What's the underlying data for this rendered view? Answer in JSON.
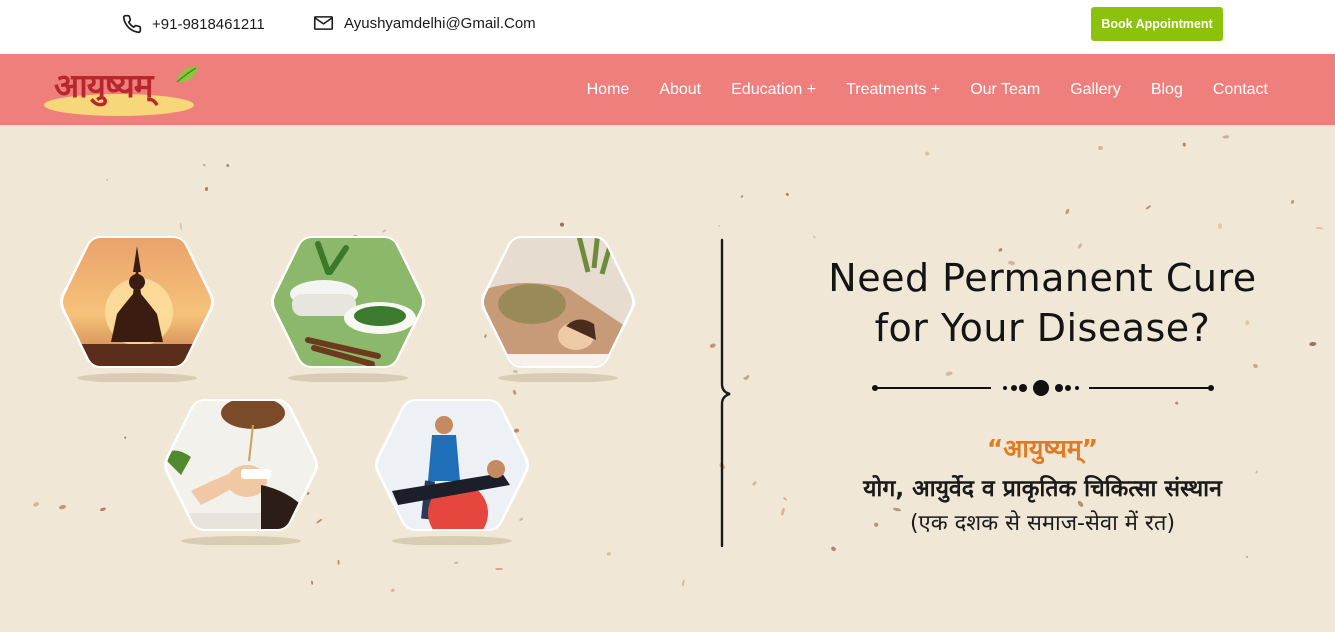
{
  "topbar": {
    "phone": "+91-9818461211",
    "email": "Ayushyamdelhi@Gmail.Com",
    "book_button": "Book Appointment",
    "button_color": "#8cc20c"
  },
  "nav": {
    "logo_text": "आयुष्यम्",
    "items": [
      {
        "label": "Home"
      },
      {
        "label": "About"
      },
      {
        "label": "Education +"
      },
      {
        "label": "Treatments +"
      },
      {
        "label": "Our Team"
      },
      {
        "label": "Gallery"
      },
      {
        "label": "Blog"
      },
      {
        "label": "Contact"
      }
    ],
    "background_color": "#ef7f7d"
  },
  "hero": {
    "headline_line1": "Need Permanent Cure",
    "headline_line2": "for Your Disease?",
    "brand_quote": "“आयुष्यम्”",
    "tagline": "योग, आयुर्वेद व प्राकृतिक चिकित्सा संस्थान",
    "subtagline": "(एक दशक से समाज-सेवा में रत)",
    "images": [
      {
        "name": "yoga-meditation-image"
      },
      {
        "name": "herbal-medicine-image"
      },
      {
        "name": "herbal-massage-image"
      },
      {
        "name": "shirodhara-therapy-image"
      },
      {
        "name": "physiotherapy-ball-image"
      }
    ],
    "background_color": "#f0e7d6",
    "accent_color": "#e07b22"
  }
}
